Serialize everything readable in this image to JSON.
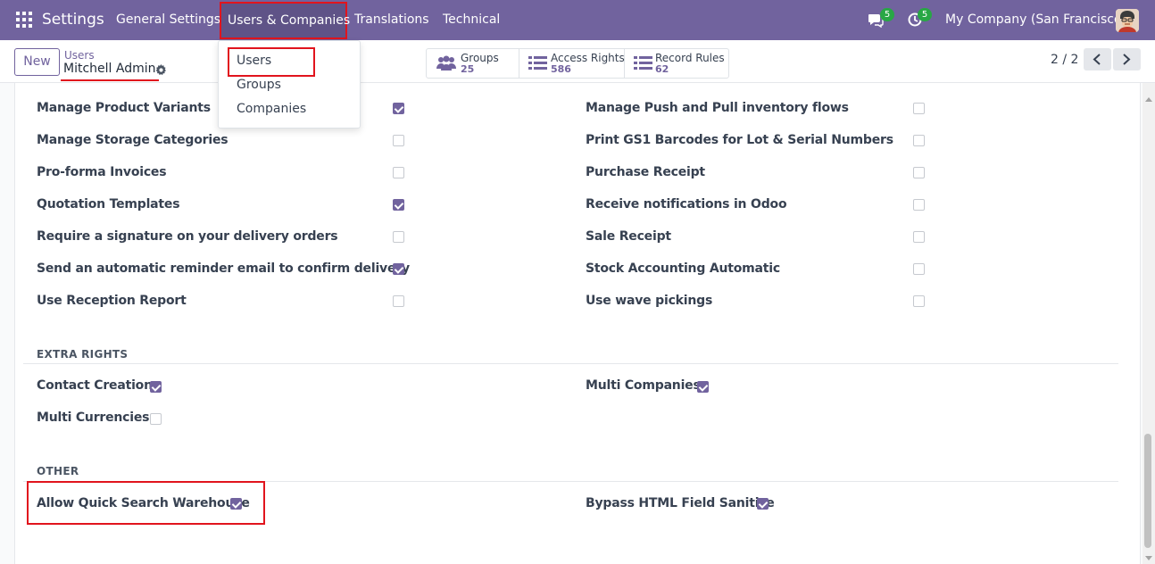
{
  "navbar": {
    "app_name": "Settings",
    "menu": [
      "General Settings",
      "Users & Companies",
      "Translations",
      "Technical"
    ],
    "messages_count": "5",
    "activities_count": "5",
    "company": "My Company (San Francisco)"
  },
  "dropdown": {
    "items": [
      "Users",
      "Groups",
      "Companies"
    ]
  },
  "control": {
    "new_label": "New",
    "breadcrumb_parent": "Users",
    "breadcrumb_current": "Mitchell Admin",
    "smart_buttons": [
      {
        "label": "Groups",
        "value": "25",
        "icon": "users-icon"
      },
      {
        "label": "Access Rights",
        "value": "586",
        "icon": "list-icon"
      },
      {
        "label": "Record Rules",
        "value": "62",
        "icon": "list-icon"
      }
    ],
    "pager": "2 / 2"
  },
  "accent_color": "#71639e",
  "highlight_color": "#e1141d",
  "technical_rows": {
    "left": [
      {
        "label": "Manage Product Variants",
        "checked": true
      },
      {
        "label": "Manage Storage Categories",
        "checked": false
      },
      {
        "label": "Pro-forma Invoices",
        "checked": false
      },
      {
        "label": "Quotation Templates",
        "checked": true
      },
      {
        "label": "Require a signature on your delivery orders",
        "checked": false
      },
      {
        "label": "Send an automatic reminder email to confirm delivery",
        "checked": true
      },
      {
        "label": "Use Reception Report",
        "checked": false
      }
    ],
    "right": [
      {
        "label": "Manage Push and Pull inventory flows",
        "checked": false
      },
      {
        "label": "Print GS1 Barcodes for Lot & Serial Numbers",
        "checked": false
      },
      {
        "label": "Purchase Receipt",
        "checked": false
      },
      {
        "label": "Receive notifications in Odoo",
        "checked": false
      },
      {
        "label": "Sale Receipt",
        "checked": false
      },
      {
        "label": "Stock Accounting Automatic",
        "checked": false
      },
      {
        "label": "Use wave pickings",
        "checked": false
      }
    ]
  },
  "extra_rights": {
    "title": "EXTRA RIGHTS",
    "items": [
      {
        "label": "Contact Creation",
        "checked": true
      },
      {
        "label": "Multi Companies",
        "checked": true
      },
      {
        "label": "Multi Currencies",
        "checked": false
      }
    ]
  },
  "other": {
    "title": "OTHER",
    "items": [
      {
        "label": "Allow Quick Search Warehouse",
        "checked": true
      },
      {
        "label": "Bypass HTML Field Sanitize",
        "checked": true
      }
    ]
  }
}
